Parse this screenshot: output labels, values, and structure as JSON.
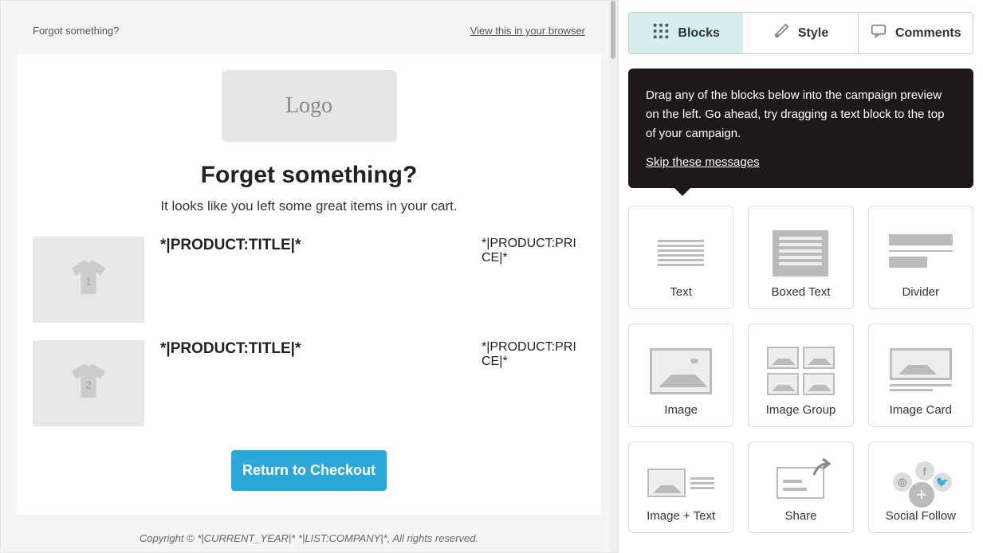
{
  "preview": {
    "forgot_text": "Forgot something?",
    "browser_link": "View this in your browser",
    "logo_text": "Logo",
    "headline": "Forget something?",
    "subhead": "It looks like you left some great items in your cart.",
    "products": [
      {
        "title": "*|PRODUCT:TITLE|*",
        "price": "*|PRODUCT:PRICE|*",
        "num": "1"
      },
      {
        "title": "*|PRODUCT:TITLE|*",
        "price": "*|PRODUCT:PRICE|*",
        "num": "2"
      }
    ],
    "cta_label": "Return to Checkout",
    "footer": "Copyright © *|CURRENT_YEAR|* *|LIST:COMPANY|*, All rights reserved."
  },
  "sidebar": {
    "tabs": {
      "blocks": "Blocks",
      "style": "Style",
      "comments": "Comments"
    },
    "tooltip": {
      "text": "Drag any of the blocks below into the campaign preview on the left. Go ahead, try dragging a text block to the top of your campaign.",
      "skip": "Skip these messages"
    },
    "blocks": {
      "text": "Text",
      "boxed_text": "Boxed Text",
      "divider": "Divider",
      "image": "Image",
      "image_group": "Image Group",
      "image_card": "Image Card",
      "image_text": "Image + Text",
      "share": "Share",
      "social_follow": "Social Follow"
    }
  }
}
